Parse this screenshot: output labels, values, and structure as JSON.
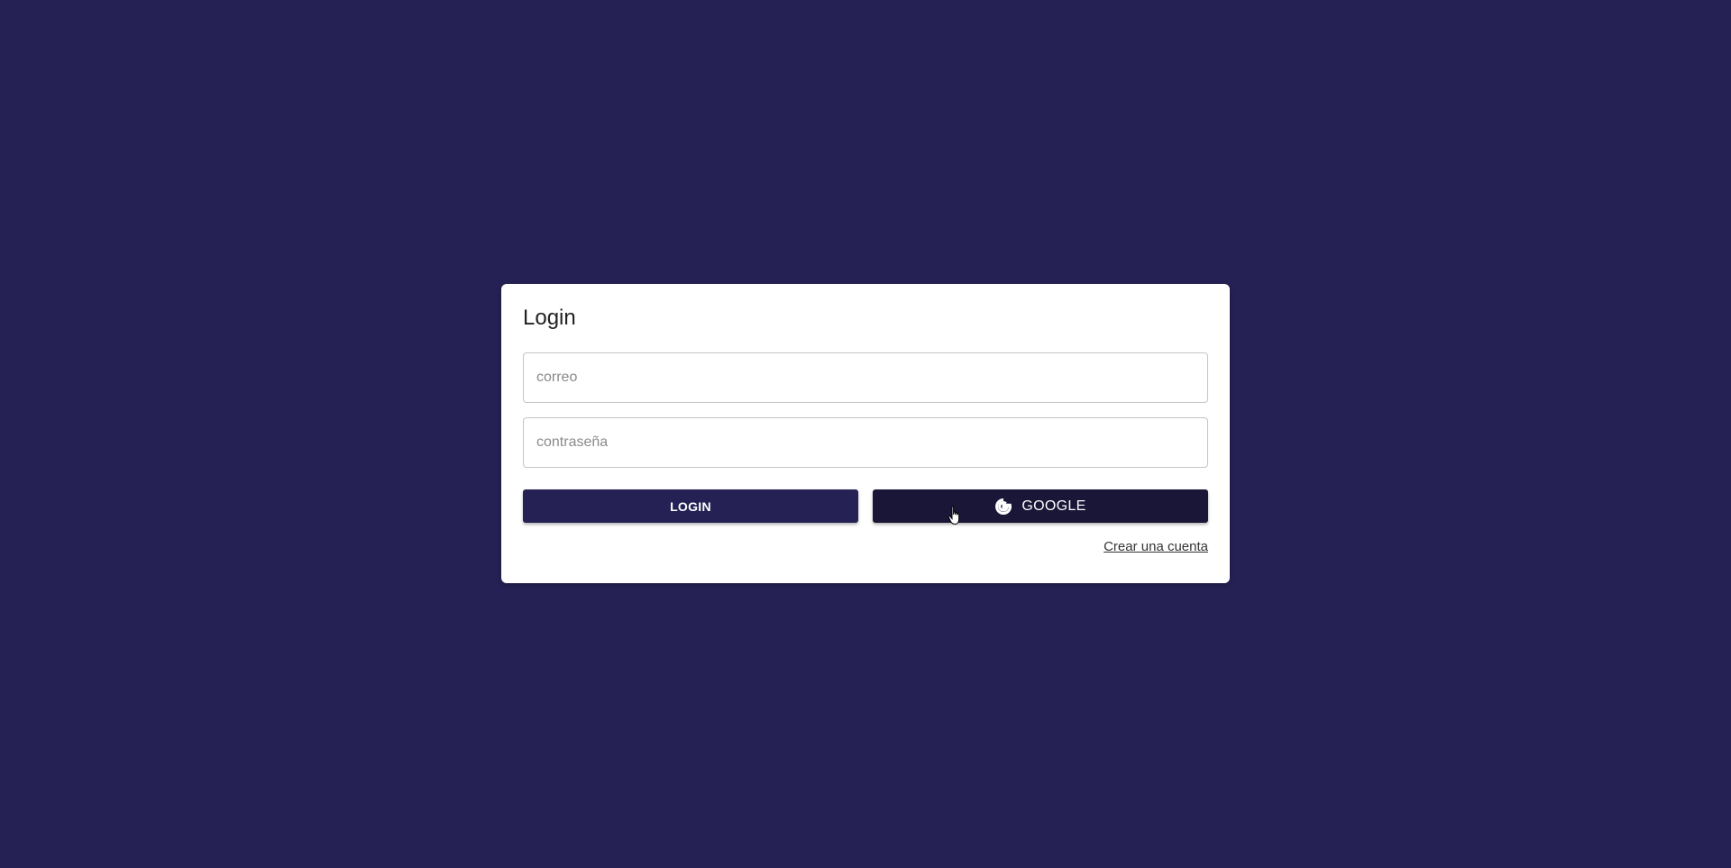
{
  "login_card": {
    "title": "Login",
    "email_placeholder": "correo",
    "password_placeholder": "contraseña",
    "login_button_label": "LOGIN",
    "google_button_label": "GOOGLE",
    "google_icon": "google-icon",
    "create_account_link": "Crear una cuenta"
  },
  "colors": {
    "background": "#252154",
    "login_button": "#252154",
    "google_button": "#191637",
    "card": "#ffffff"
  }
}
